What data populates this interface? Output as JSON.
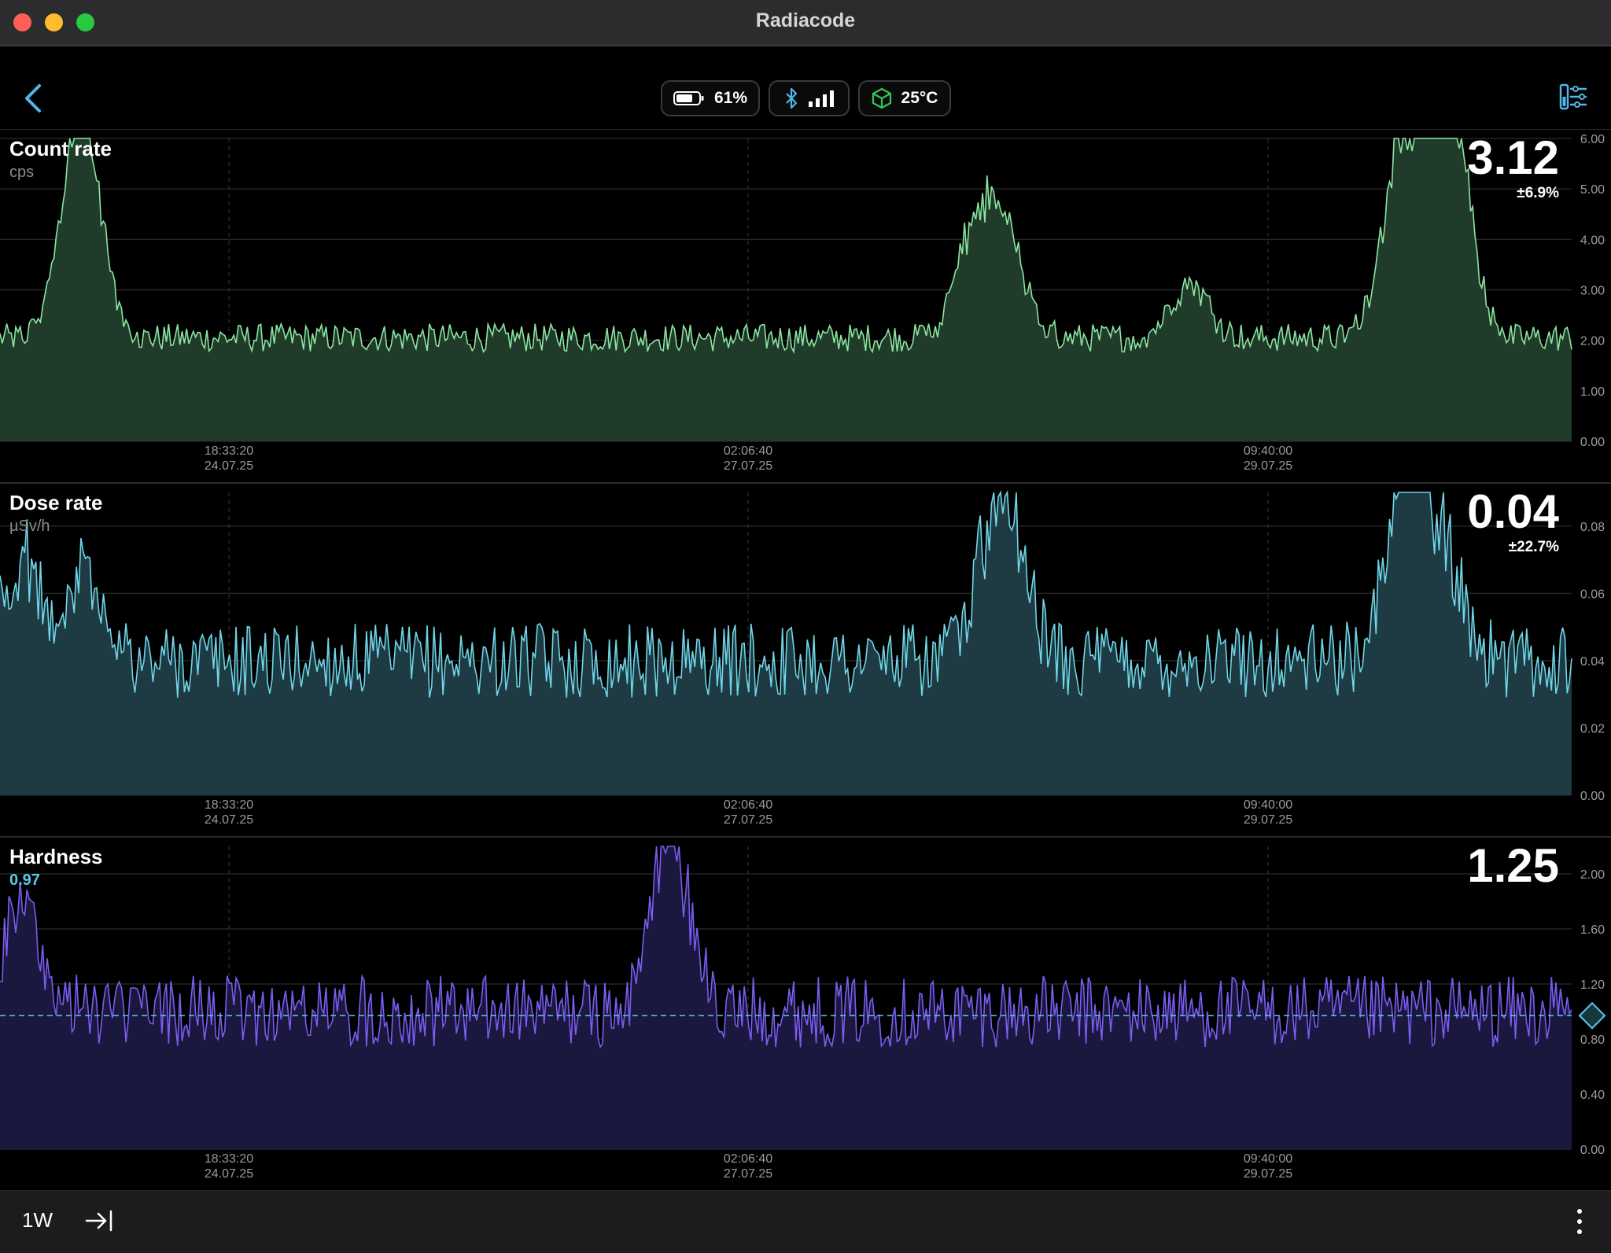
{
  "window": {
    "title": "Radiacode"
  },
  "status": {
    "battery": "61%",
    "temperature": "25°C"
  },
  "colors": {
    "count_line": "#8ae6a0",
    "count_fill": "#213b2a",
    "dose_line": "#6ed6e8",
    "dose_fill": "#1e3a42",
    "hard_line": "#7b5cf0",
    "hard_fill": "#1b1840",
    "marker": "#5ac8e8"
  },
  "panels": {
    "count": {
      "title": "Count rate",
      "unit": "cps",
      "value": "3.12",
      "error": "±6.9%"
    },
    "dose": {
      "title": "Dose rate",
      "unit": "µSv/h",
      "value": "0.04",
      "error": "±22.7%"
    },
    "hardness": {
      "title": "Hardness",
      "marker_value": "0.97",
      "value": "1.25"
    }
  },
  "bottom": {
    "range": "1W"
  },
  "chart_data": [
    {
      "type": "area",
      "title": "Count rate",
      "ylabel": "cps",
      "ylim": [
        0,
        6
      ],
      "y_ticks": [
        "6.00",
        "5.00",
        "4.00",
        "3.00",
        "2.00",
        "1.00",
        "0.00"
      ],
      "x_ticks": [
        {
          "time": "18:33:20",
          "date": "24.07.25"
        },
        {
          "time": "02:06:40",
          "date": "27.07.25"
        },
        {
          "time": "09:40:00",
          "date": "29.07.25"
        }
      ],
      "baseline": 2.05,
      "noise": 0.28,
      "peaks": [
        [
          0.048,
          4.8
        ],
        [
          0.055,
          4.5
        ],
        [
          0.62,
          4.3
        ],
        [
          0.64,
          4.1
        ],
        [
          0.757,
          3.3
        ],
        [
          0.89,
          5.8
        ],
        [
          0.915,
          5.4
        ],
        [
          0.925,
          5.3
        ]
      ]
    },
    {
      "type": "area",
      "title": "Dose rate",
      "ylabel": "µSv/h",
      "ylim": [
        0,
        0.09
      ],
      "y_ticks": [
        "0.08",
        "0.06",
        "0.04",
        "0.02",
        "0.00"
      ],
      "x_ticks": [
        {
          "time": "18:33:20",
          "date": "24.07.25"
        },
        {
          "time": "02:06:40",
          "date": "27.07.25"
        },
        {
          "time": "09:40:00",
          "date": "29.07.25"
        }
      ],
      "baseline": 0.04,
      "noise": 0.011,
      "peaks": [
        [
          0.014,
          0.073
        ],
        [
          0.054,
          0.071
        ],
        [
          0.63,
          0.078
        ],
        [
          0.645,
          0.07
        ],
        [
          0.89,
          0.07
        ],
        [
          0.9,
          0.087
        ],
        [
          0.92,
          0.067
        ]
      ]
    },
    {
      "type": "area",
      "title": "Hardness",
      "ylim": [
        0,
        2.2
      ],
      "y_ticks": [
        "2.00",
        "1.60",
        "1.20",
        "0.80",
        "0.40",
        "0.00"
      ],
      "x_ticks": [
        {
          "time": "18:33:20",
          "date": "24.07.25"
        },
        {
          "time": "02:06:40",
          "date": "27.07.25"
        },
        {
          "time": "09:40:00",
          "date": "29.07.25"
        }
      ],
      "baseline": 1.0,
      "noise": 0.26,
      "reference_line": 0.97,
      "peaks": [
        [
          0.014,
          1.9
        ],
        [
          0.425,
          1.84
        ],
        [
          0.4265,
          1.7
        ]
      ]
    }
  ]
}
